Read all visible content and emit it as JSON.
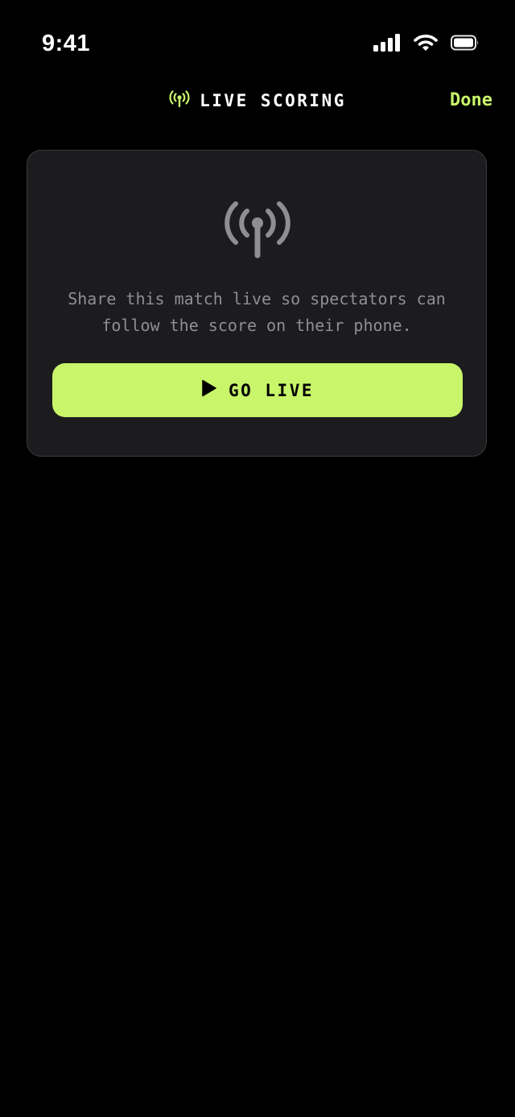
{
  "status_bar": {
    "time": "9:41"
  },
  "header": {
    "title": "LIVE SCORING",
    "title_icon": "broadcast-icon",
    "done_label": "Done"
  },
  "card": {
    "icon": "broadcast-icon",
    "description": "Share this match live so spectators can follow the score on their phone.",
    "button_label": "GO LIVE",
    "button_icon": "play-icon"
  },
  "colors": {
    "background": "#000000",
    "accent": "#c8f56a",
    "card_background": "#1c1c1e",
    "muted_text": "#8e8e93"
  }
}
